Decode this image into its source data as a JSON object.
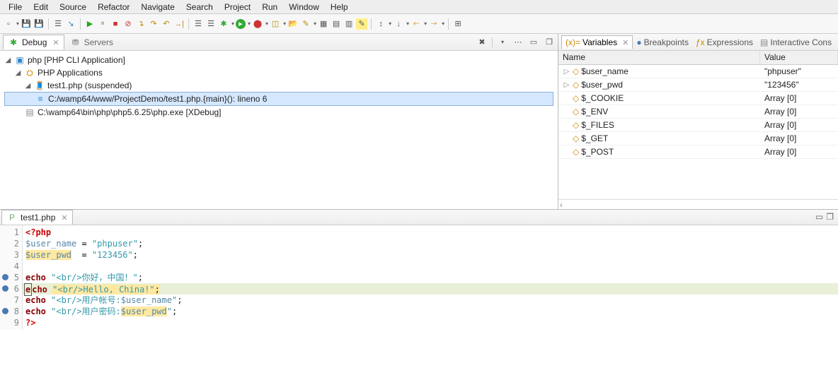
{
  "menu": [
    "File",
    "Edit",
    "Source",
    "Refactor",
    "Navigate",
    "Search",
    "Project",
    "Run",
    "Window",
    "Help"
  ],
  "debug_tab": "Debug",
  "servers_tab": "Servers",
  "tree": {
    "root": "php [PHP CLI Application]",
    "app": "PHP Applications",
    "thread": "test1.php (suspended)",
    "frame": "C:/wamp64/www/ProjectDemo/test1.php.{main}(): lineno 6",
    "exe": "C:\\wamp64\\bin\\php\\php5.6.25\\php.exe [XDebug]"
  },
  "vars_tabs": {
    "variables": "Variables",
    "breakpoints": "Breakpoints",
    "expressions": "Expressions",
    "interactive": "Interactive Cons"
  },
  "var_head": {
    "name": "Name",
    "value": "Value"
  },
  "vars": [
    {
      "name": "$user_name",
      "value": "\"phpuser\"",
      "exp": true
    },
    {
      "name": "$user_pwd",
      "value": "\"123456\"",
      "exp": true
    },
    {
      "name": "$_COOKIE",
      "value": "Array [0]"
    },
    {
      "name": "$_ENV",
      "value": "Array [0]"
    },
    {
      "name": "$_FILES",
      "value": "Array [0]"
    },
    {
      "name": "$_GET",
      "value": "Array [0]"
    },
    {
      "name": "$_POST",
      "value": "Array [0]"
    }
  ],
  "editor_tab": "test1.php",
  "code_lines": [
    {
      "n": 1,
      "html": "<span class='php-tag'>&lt;?php</span>"
    },
    {
      "n": 2,
      "html": "<span class='php-var'>$user_name</span> <span class='php-op'>=</span> <span class='php-str'>\"phpuser\"</span>;"
    },
    {
      "n": 3,
      "html": "<span class='hl-assign'><span class='php-var'>$user_pwd</span></span>  <span class='php-op'>=</span> <span class='php-str'>\"123456\"</span>;"
    },
    {
      "n": 4,
      "html": ""
    },
    {
      "n": 5,
      "html": "<span class='php-kw'>echo</span> <span class='php-str'>\"&lt;br/&gt;你好，中国！\"</span>;",
      "bp": true
    },
    {
      "n": 6,
      "html": "<span class='cur-box'><span class='php-kw'>e</span></span><span class='php-kw'>cho</span> <span class='hl-assign'><span class='php-str'>\"&lt;br/&gt;Hello, China!\"</span>;</span>",
      "bp": true,
      "cur": true
    },
    {
      "n": 7,
      "html": "<span class='php-kw'>echo</span> <span class='php-str'>\"&lt;br/&gt;用户帐号:<span class='php-var'>$user_name</span>\"</span>;"
    },
    {
      "n": 8,
      "html": "<span class='php-kw'>echo</span> <span class='php-str'>\"&lt;br/&gt;用户密码:<span class='hl-assign'><span class='php-var'>$user_pwd</span></span>\"</span>;",
      "bp": true
    },
    {
      "n": 9,
      "html": "<span class='php-tag'>?&gt;</span>"
    }
  ]
}
